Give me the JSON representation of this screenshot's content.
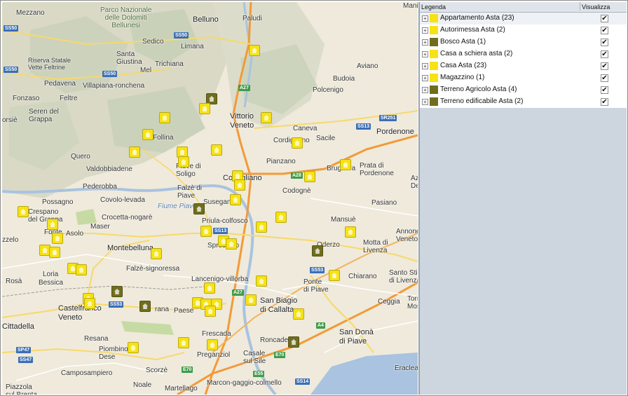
{
  "legend": {
    "header_label": "Legenda",
    "header_visibility": "Visualizza",
    "items": [
      {
        "label": "Appartamento Asta (23)",
        "color": "#f7e214",
        "checked": "✔"
      },
      {
        "label": "Autorimessa Asta (2)",
        "color": "#f7e214",
        "checked": "✔"
      },
      {
        "label": "Bosco Asta (1)",
        "color": "#6f6e1e",
        "checked": "✔"
      },
      {
        "label": "Casa a schiera asta (2)",
        "color": "#f7e214",
        "checked": "✔"
      },
      {
        "label": "Casa Asta (23)",
        "color": "#f7e214",
        "checked": "✔"
      },
      {
        "label": "Magazzino (1)",
        "color": "#f7e214",
        "checked": "✔"
      },
      {
        "label": "Terreno Agricolo Asta (4)",
        "color": "#6f6e1e",
        "checked": "✔"
      },
      {
        "label": "Terreno edificabile Asta (2)",
        "color": "#6f6e1e",
        "checked": "✔"
      }
    ]
  },
  "map": {
    "places": {
      "mezzano": "Mezzano",
      "parco": "Parco Nazionale\ndelle Dolomiti\nBellunesi",
      "belluno": "Belluno",
      "paludi": "Paludi",
      "mani": "Mani",
      "sedico": "Sedico",
      "limana": "Limana",
      "santa_giustina": "Santa\nGiustina",
      "trichiana": "Trichiana",
      "mel": "Mel",
      "riserva": "Riserva Statale\nVette Feltrine",
      "pedavena": "Pedavena",
      "villapiana": "Villapiana-ronchena",
      "aviano": "Aviano",
      "budoia": "Budoia",
      "fonzaso": "Fonzaso",
      "feltre": "Feltre",
      "polcenigo": "Polcenigo",
      "seren": "Seren del\nGrappa",
      "vittorio": "Vittorio\nVeneto",
      "caneva": "Caneva",
      "sacile": "Sacile",
      "pordenone": "Pordenone",
      "follina": "Follina",
      "cordignano": "Cordignano",
      "quero": "Quero",
      "valdobbiadene": "Valdobbiadene",
      "pieve_di_soligo": "Pieve di\nSoligo",
      "conegliano": "Conegliano",
      "pianzano": "Pianzano",
      "brugnera": "Brugnera",
      "prata": "Prata di\nPordenone",
      "pederobba": "Pederobba",
      "falze": "Falzè di\nPiave",
      "codogne": "Codognè",
      "covolo": "Covolo-levada",
      "susegana": "Susegana",
      "azzano": "Azzano\nDecimo",
      "fiume_piave": "Fiume Piave",
      "pasiano": "Pasiano",
      "possagno": "Possagno",
      "crespano": "Crespano\ndel Grappa",
      "crocetta": "Crocetta-nogarè",
      "priula": "Priula-colfosco",
      "mansue": "Mansuè",
      "fonte": "Fonte",
      "asolo": "Asolo",
      "maser": "Maser",
      "annone": "Annone\nVeneto",
      "mussolente": "zzelo",
      "montebelluna": "Montebelluna",
      "spresiano": "Spresiano",
      "oderzo": "Oderzo",
      "motta": "Motta di\nLivenza",
      "loria": "Loria",
      "bessica": "Bessica",
      "falze_sign": "Falzè-signoressa",
      "lancenigo": "Lancenigo-villorba",
      "chiarano": "Chiarano",
      "santo_stino": "Santo Stino\ndi Livenza",
      "rosa": "Rosà",
      "ponte_di_piave": "Ponte\ndi Piave",
      "castelfranco": "Castelfranco\nVeneto",
      "paese": "Paese",
      "istrana": "rana",
      "san_biagio": "San Biagio\ndi Callalta",
      "ceggia": "Ceggia",
      "torre_mosto": "Torre\nMos",
      "cittadella": "Cittadella",
      "resana": "Resana",
      "frescada": "Frescada",
      "san_dona": "San Donà\ndi Piave",
      "roncade": "Roncade",
      "piombino": "Piombino\nDese",
      "preganziol": "Preganziol",
      "casale": "Casale\nsul Sile",
      "eraclea": "Eraclea",
      "camposampiero": "Camposampiero",
      "scorze": "Scorzè",
      "noale": "Noale",
      "martellago": "Martellago",
      "marcon": "Marcon-gaggio-colmello",
      "piazzola": "Piazzola\nsul Brenta",
      "orsie": "orsiè",
      "pezzo": "zzelo"
    },
    "roads": {
      "ss50a": "SS50",
      "ss50b": "SS50",
      "ss50c": "SS50",
      "ss50d": "SS50",
      "a27a": "A27",
      "a27b": "A27",
      "sr251": "SR251",
      "ss13a": "SS13",
      "ss13b": "SS13",
      "a28": "A28",
      "ss53a": "SS53",
      "ss53b": "SS53",
      "a4": "A4",
      "sp47": "SP47",
      "ss47": "SS47",
      "e70a": "E70",
      "e70b": "E70",
      "e55": "E55",
      "ss14": "SS14"
    }
  }
}
